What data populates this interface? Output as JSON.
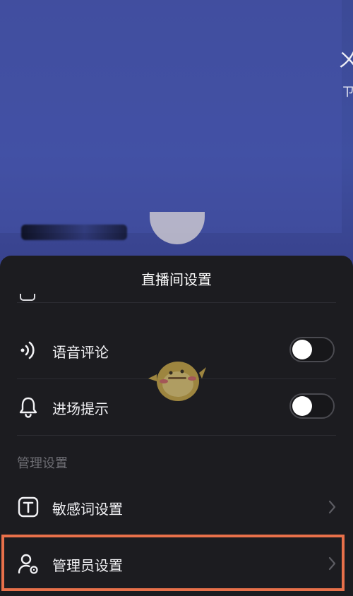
{
  "sheet": {
    "title": "直播间设置"
  },
  "settings": [
    {
      "label": "语音评论",
      "icon": "voice-comment-icon",
      "enabled": false
    },
    {
      "label": "进场提示",
      "icon": "bell-icon",
      "enabled": false
    }
  ],
  "management": {
    "section_label": "管理设置",
    "items": [
      {
        "label": "敏感词设置",
        "icon": "text-t-icon"
      },
      {
        "label": "管理员设置",
        "icon": "admin-user-icon"
      }
    ]
  },
  "colors": {
    "highlight": "#e8704a",
    "sheet_bg": "#1c1c20",
    "video_bg": "#3f4fa0"
  }
}
